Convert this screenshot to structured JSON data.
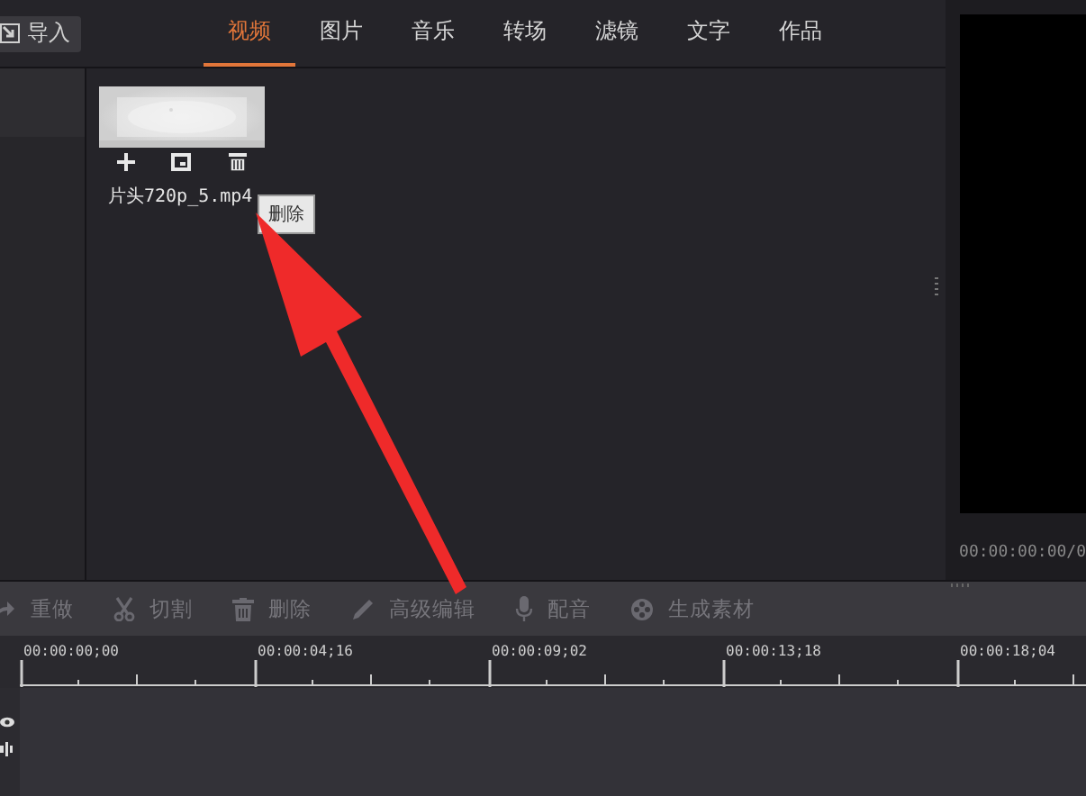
{
  "import_button": {
    "label": "导入"
  },
  "tabs": [
    {
      "label": "视频",
      "selected": true
    },
    {
      "label": "图片",
      "selected": false
    },
    {
      "label": "音乐",
      "selected": false
    },
    {
      "label": "转场",
      "selected": false
    },
    {
      "label": "滤镜",
      "selected": false
    },
    {
      "label": "文字",
      "selected": false
    },
    {
      "label": "作品",
      "selected": false
    }
  ],
  "media": [
    {
      "filename": "片头720p_5.mp4"
    }
  ],
  "tooltip": {
    "text": "删除"
  },
  "preview": {
    "time": "00:00:00:00/0"
  },
  "toolbar": [
    {
      "label": "重做",
      "kind": "redo"
    },
    {
      "label": "切割",
      "kind": "cut"
    },
    {
      "label": "删除",
      "kind": "delete"
    },
    {
      "label": "高级编辑",
      "kind": "edit"
    },
    {
      "label": "配音",
      "kind": "dub"
    },
    {
      "label": "生成素材",
      "kind": "render"
    }
  ],
  "timeline": {
    "marks": [
      "00:00:00;00",
      "00:00:04;16",
      "00:00:09;02",
      "00:00:13;18",
      "00:00:18;04"
    ]
  }
}
